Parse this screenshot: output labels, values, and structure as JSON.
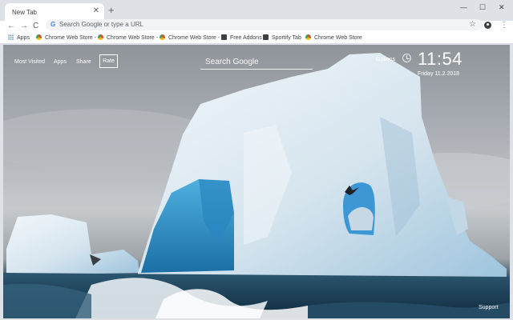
{
  "browser": {
    "tab": {
      "title": "New Tab",
      "close_glyph": "✕"
    },
    "new_tab_glyph": "+",
    "window_controls": {
      "minimize": "—",
      "maximize": "☐",
      "close": "✕"
    },
    "toolbar": {
      "back_glyph": "←",
      "forward_glyph": "→",
      "reload_glyph": "C",
      "omnibox_placeholder": "Search Google or type a URL",
      "star_glyph": "☆",
      "menu_glyph": "⋮"
    },
    "bookmarks": [
      {
        "label": "Apps",
        "icon": "apps-grid-icon"
      },
      {
        "label": "Chrome Web Store -",
        "icon": "chrome-web-store-icon"
      },
      {
        "label": "Chrome Web Store -",
        "icon": "chrome-web-store-icon"
      },
      {
        "label": "Chrome Web Store -",
        "icon": "chrome-web-store-icon"
      },
      {
        "label": "Free Addons",
        "icon": "free-addons-icon"
      },
      {
        "label": "Sportify Tab",
        "icon": "sportify-tab-icon"
      },
      {
        "label": "Chrome Web Store",
        "icon": "chrome-web-store-icon"
      }
    ]
  },
  "newtab": {
    "nav": {
      "most_visited": "Most Visited",
      "apps": "Apps",
      "share": "Share",
      "rate": "Rate"
    },
    "search_placeholder": "Search Google",
    "options": "Options",
    "time": "11:54",
    "date": "Friday  11.2.2018",
    "support": "Support"
  },
  "colors": {
    "chrome_frame": "#dee1e6",
    "ice": "#dbe8f1",
    "ice_shadow": "#2e8fc4",
    "sea": "#1b3a53"
  }
}
